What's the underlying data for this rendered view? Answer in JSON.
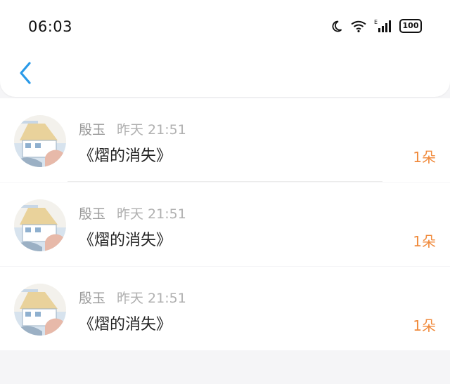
{
  "status_bar": {
    "time": "06:03",
    "battery": "100"
  },
  "list": [
    {
      "name": "殷玉",
      "time": "昨天 21:51",
      "title": "《熠的消失》",
      "count": "1朵"
    },
    {
      "name": "殷玉",
      "time": "昨天 21:51",
      "title": "《熠的消失》",
      "count": "1朵"
    },
    {
      "name": "殷玉",
      "time": "昨天 21:51",
      "title": "《熠的消失》",
      "count": "1朵"
    }
  ],
  "colors": {
    "accent": "#2a9ae8",
    "count": "#f08a3c"
  }
}
